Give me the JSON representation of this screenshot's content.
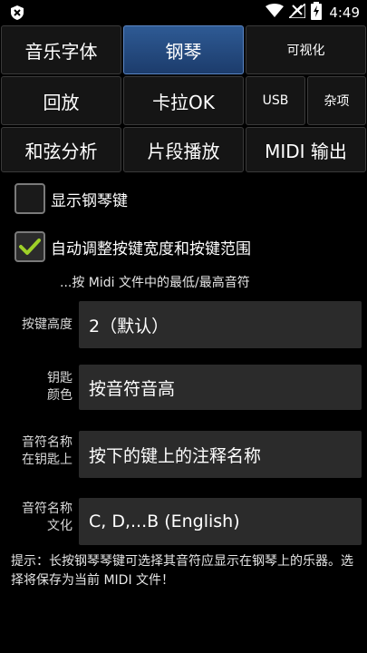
{
  "status_bar": {
    "time": "4:49"
  },
  "tabs": {
    "music_font": "音乐字体",
    "piano": "钢琴",
    "visualize": "可视化",
    "playback": "回放",
    "karaoke": "卡拉OK",
    "usb": "USB",
    "misc": "杂项",
    "chord_analysis": "和弦分析",
    "segment_play": "片段播放",
    "midi_output": "MIDI 输出"
  },
  "settings": {
    "show_piano_keys": {
      "label": "显示钢琴键",
      "checked": false
    },
    "auto_adjust": {
      "label": "自动调整按键宽度和按键范围",
      "checked": true
    },
    "auto_adjust_hint": "...按 Midi 文件中的最低/最高音符",
    "key_height": {
      "label": "按键高度",
      "value": "2（默认）"
    },
    "key_color": {
      "label_line1": "钥匙",
      "label_line2": "颜色",
      "value": "按音符音高"
    },
    "note_name_on_key": {
      "label_line1": "音符名称",
      "label_line2": "在钥匙上",
      "value": "按下的键上的注释名称"
    },
    "note_name_culture": {
      "label_line1": "音符名称",
      "label_line2": "文化",
      "value": "C, D,...B (English)"
    }
  },
  "footer_tip": "提示：长按钢琴琴键可选择其音符应显示在钢琴上的乐器。选择将保存为当前 MIDI 文件！"
}
